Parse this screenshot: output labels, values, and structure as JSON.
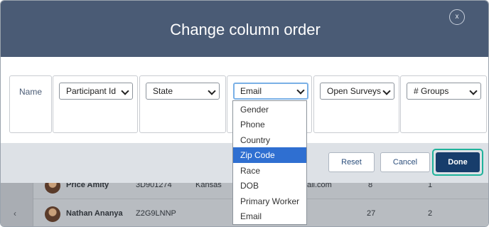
{
  "modal": {
    "title": "Change column order",
    "close_label": "x"
  },
  "columns": {
    "name_label": "Name",
    "selects": [
      {
        "value": "Participant Id"
      },
      {
        "value": "State"
      },
      {
        "value": "Email",
        "open": true
      },
      {
        "value": "Open Surveys"
      },
      {
        "value": "# Groups"
      }
    ]
  },
  "dropdown": {
    "options": [
      "Gender",
      "Phone",
      "Country",
      "Zip Code",
      "Race",
      "DOB",
      "Primary Worker",
      "Email"
    ],
    "highlighted": "Zip Code"
  },
  "footer": {
    "reset_label": "Reset",
    "cancel_label": "Cancel",
    "done_label": "Done"
  },
  "background_table": {
    "nav_icon": "‹",
    "rows": [
      {
        "name": "Price Amity",
        "id": "3D901274",
        "state": "Kansas",
        "email_fragment": "ail.com",
        "surveys": "8",
        "groups": "1"
      },
      {
        "name": "Nathan Ananya",
        "id": "Z2G9LNNP",
        "state": "",
        "email_fragment": "",
        "surveys": "27",
        "groups": "2"
      }
    ]
  },
  "colors": {
    "header_bg": "#4a5b75",
    "highlight": "#2f6fd1",
    "done_bg": "#173d6b",
    "focus_ring": "#1fb39b"
  }
}
